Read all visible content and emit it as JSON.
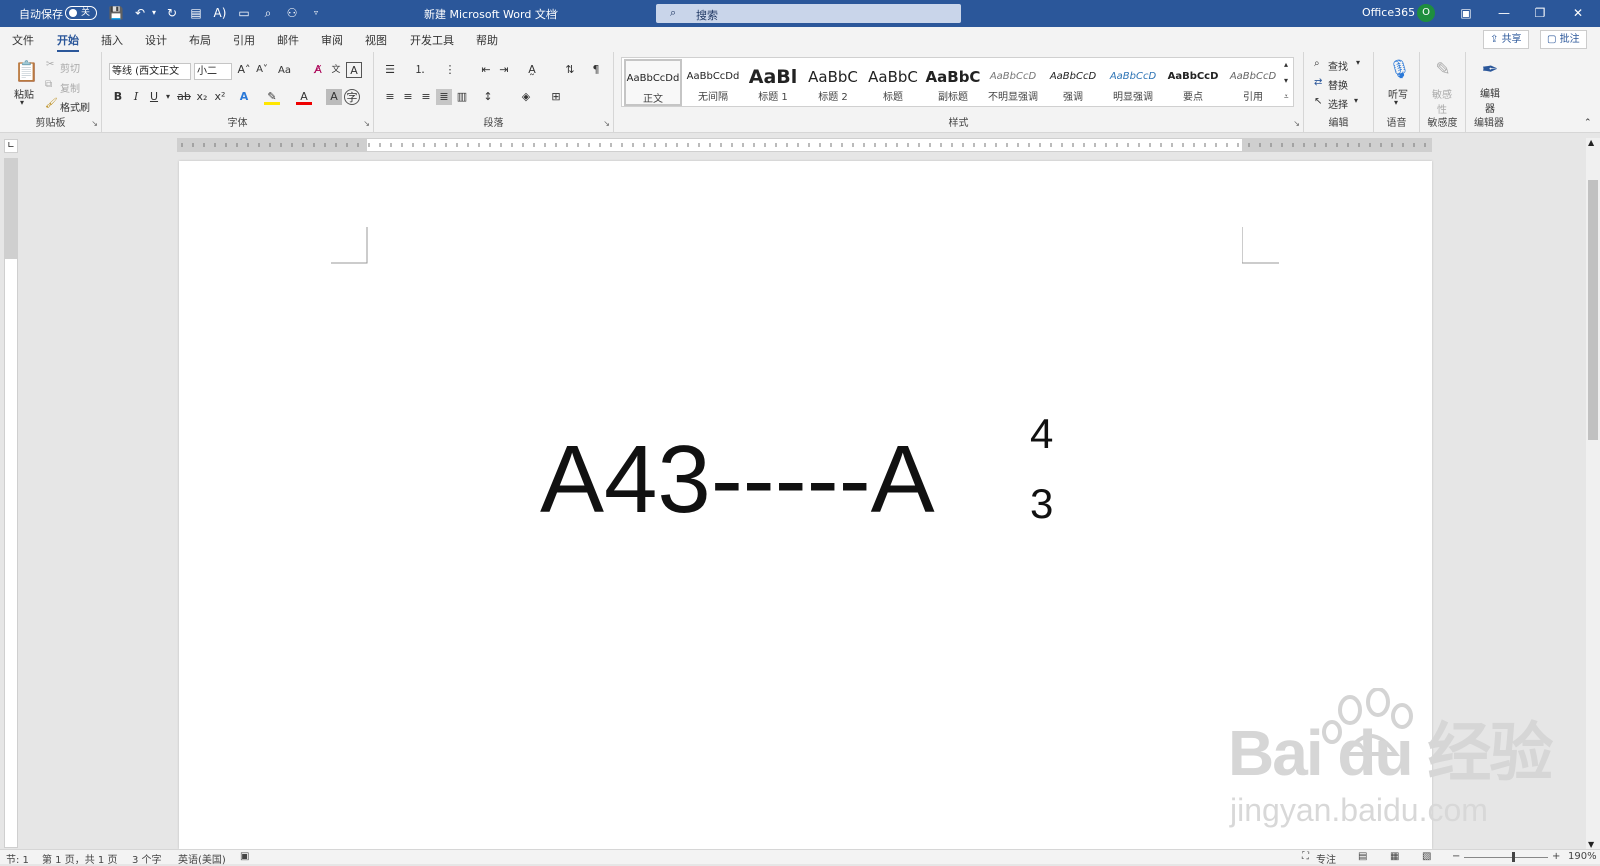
{
  "titlebar": {
    "autosave_label": "自动保存",
    "autosave_state": "关",
    "doc_title": "新建 Microsoft Word 文档",
    "title_arrow": "⌄",
    "search_placeholder": "搜索",
    "account": "Office365",
    "avatar_letter": "O"
  },
  "menu": {
    "tabs": [
      "文件",
      "开始",
      "插入",
      "设计",
      "布局",
      "引用",
      "邮件",
      "审阅",
      "视图",
      "开发工具",
      "帮助"
    ],
    "active_tab": "开始",
    "share_label": "共享",
    "comment_label": "批注"
  },
  "ribbon": {
    "clipboard": {
      "paste": "粘贴",
      "cut": "剪切",
      "copy": "复制",
      "format_painter": "格式刷",
      "label": "剪贴板"
    },
    "font": {
      "font_name": "等线 (西文正文",
      "font_size": "小二",
      "label": "字体",
      "case_btn": "Aa"
    },
    "paragraph": {
      "label": "段落"
    },
    "styles": {
      "label": "样式",
      "items": [
        {
          "preview": "AaBbCcDd",
          "name": "正文"
        },
        {
          "preview": "AaBbCcDd",
          "name": "无间隔"
        },
        {
          "preview": "AaBl",
          "name": "标题 1"
        },
        {
          "preview": "AaBbC",
          "name": "标题 2"
        },
        {
          "preview": "AaBbC",
          "name": "标题"
        },
        {
          "preview": "AaBbC",
          "name": "副标题"
        },
        {
          "preview": "AaBbCcD",
          "name": "不明显强调"
        },
        {
          "preview": "AaBbCcD",
          "name": "强调"
        },
        {
          "preview": "AaBbCcD",
          "name": "明显强调"
        },
        {
          "preview": "AaBbCcD",
          "name": "要点"
        },
        {
          "preview": "AaBbCcD",
          "name": "引用"
        }
      ]
    },
    "editing": {
      "find": "查找",
      "replace": "替换",
      "select": "选择",
      "label": "编辑"
    },
    "voice": {
      "dictate": "听写",
      "label": "语音"
    },
    "sensitivity": {
      "btn": "敏感性",
      "label": "敏感度"
    },
    "editor": {
      "btn": "编辑器",
      "label": "编辑器"
    }
  },
  "document": {
    "main_text": "A43-----A",
    "superscript": "4",
    "subscript": "3"
  },
  "statusbar": {
    "section": "节: 1",
    "page": "第 1 页，共 1 页",
    "words": "3 个字",
    "language": "英语(美国)",
    "focus": "专注",
    "zoom": "190%"
  },
  "watermark": {
    "brand": "Bai du 经验",
    "url": "jingyan.baidu.com"
  }
}
